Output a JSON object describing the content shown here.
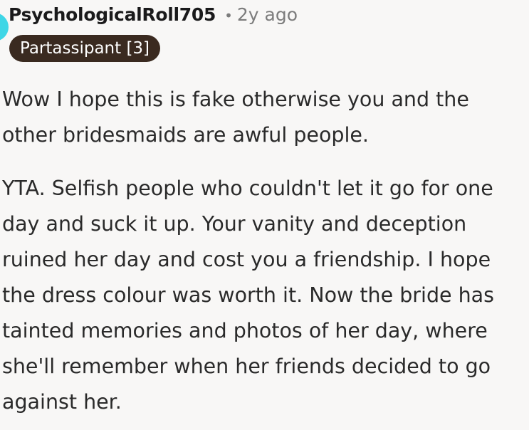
{
  "comment": {
    "username": "PsychologicalRoll705",
    "separator": "•",
    "timestamp": "2y ago",
    "flair": "Partassipant [3]",
    "paragraphs": [
      "Wow I hope this is fake otherwise you and the other bridesmaids are awful people.",
      "YTA. Selfish people who couldn't let it go for one day and suck it up. Your vanity and deception ruined her day and cost you a friendship. I hope the dress colour was worth it. Now the bride has tainted memories and photos of her day, where she'll remember when her friends decided to go against her."
    ]
  },
  "colors": {
    "background": "#f8f7f6",
    "avatar": "#3fd6e6",
    "flair_bg": "#3a2a20",
    "meta_text": "#7c7c7c"
  }
}
